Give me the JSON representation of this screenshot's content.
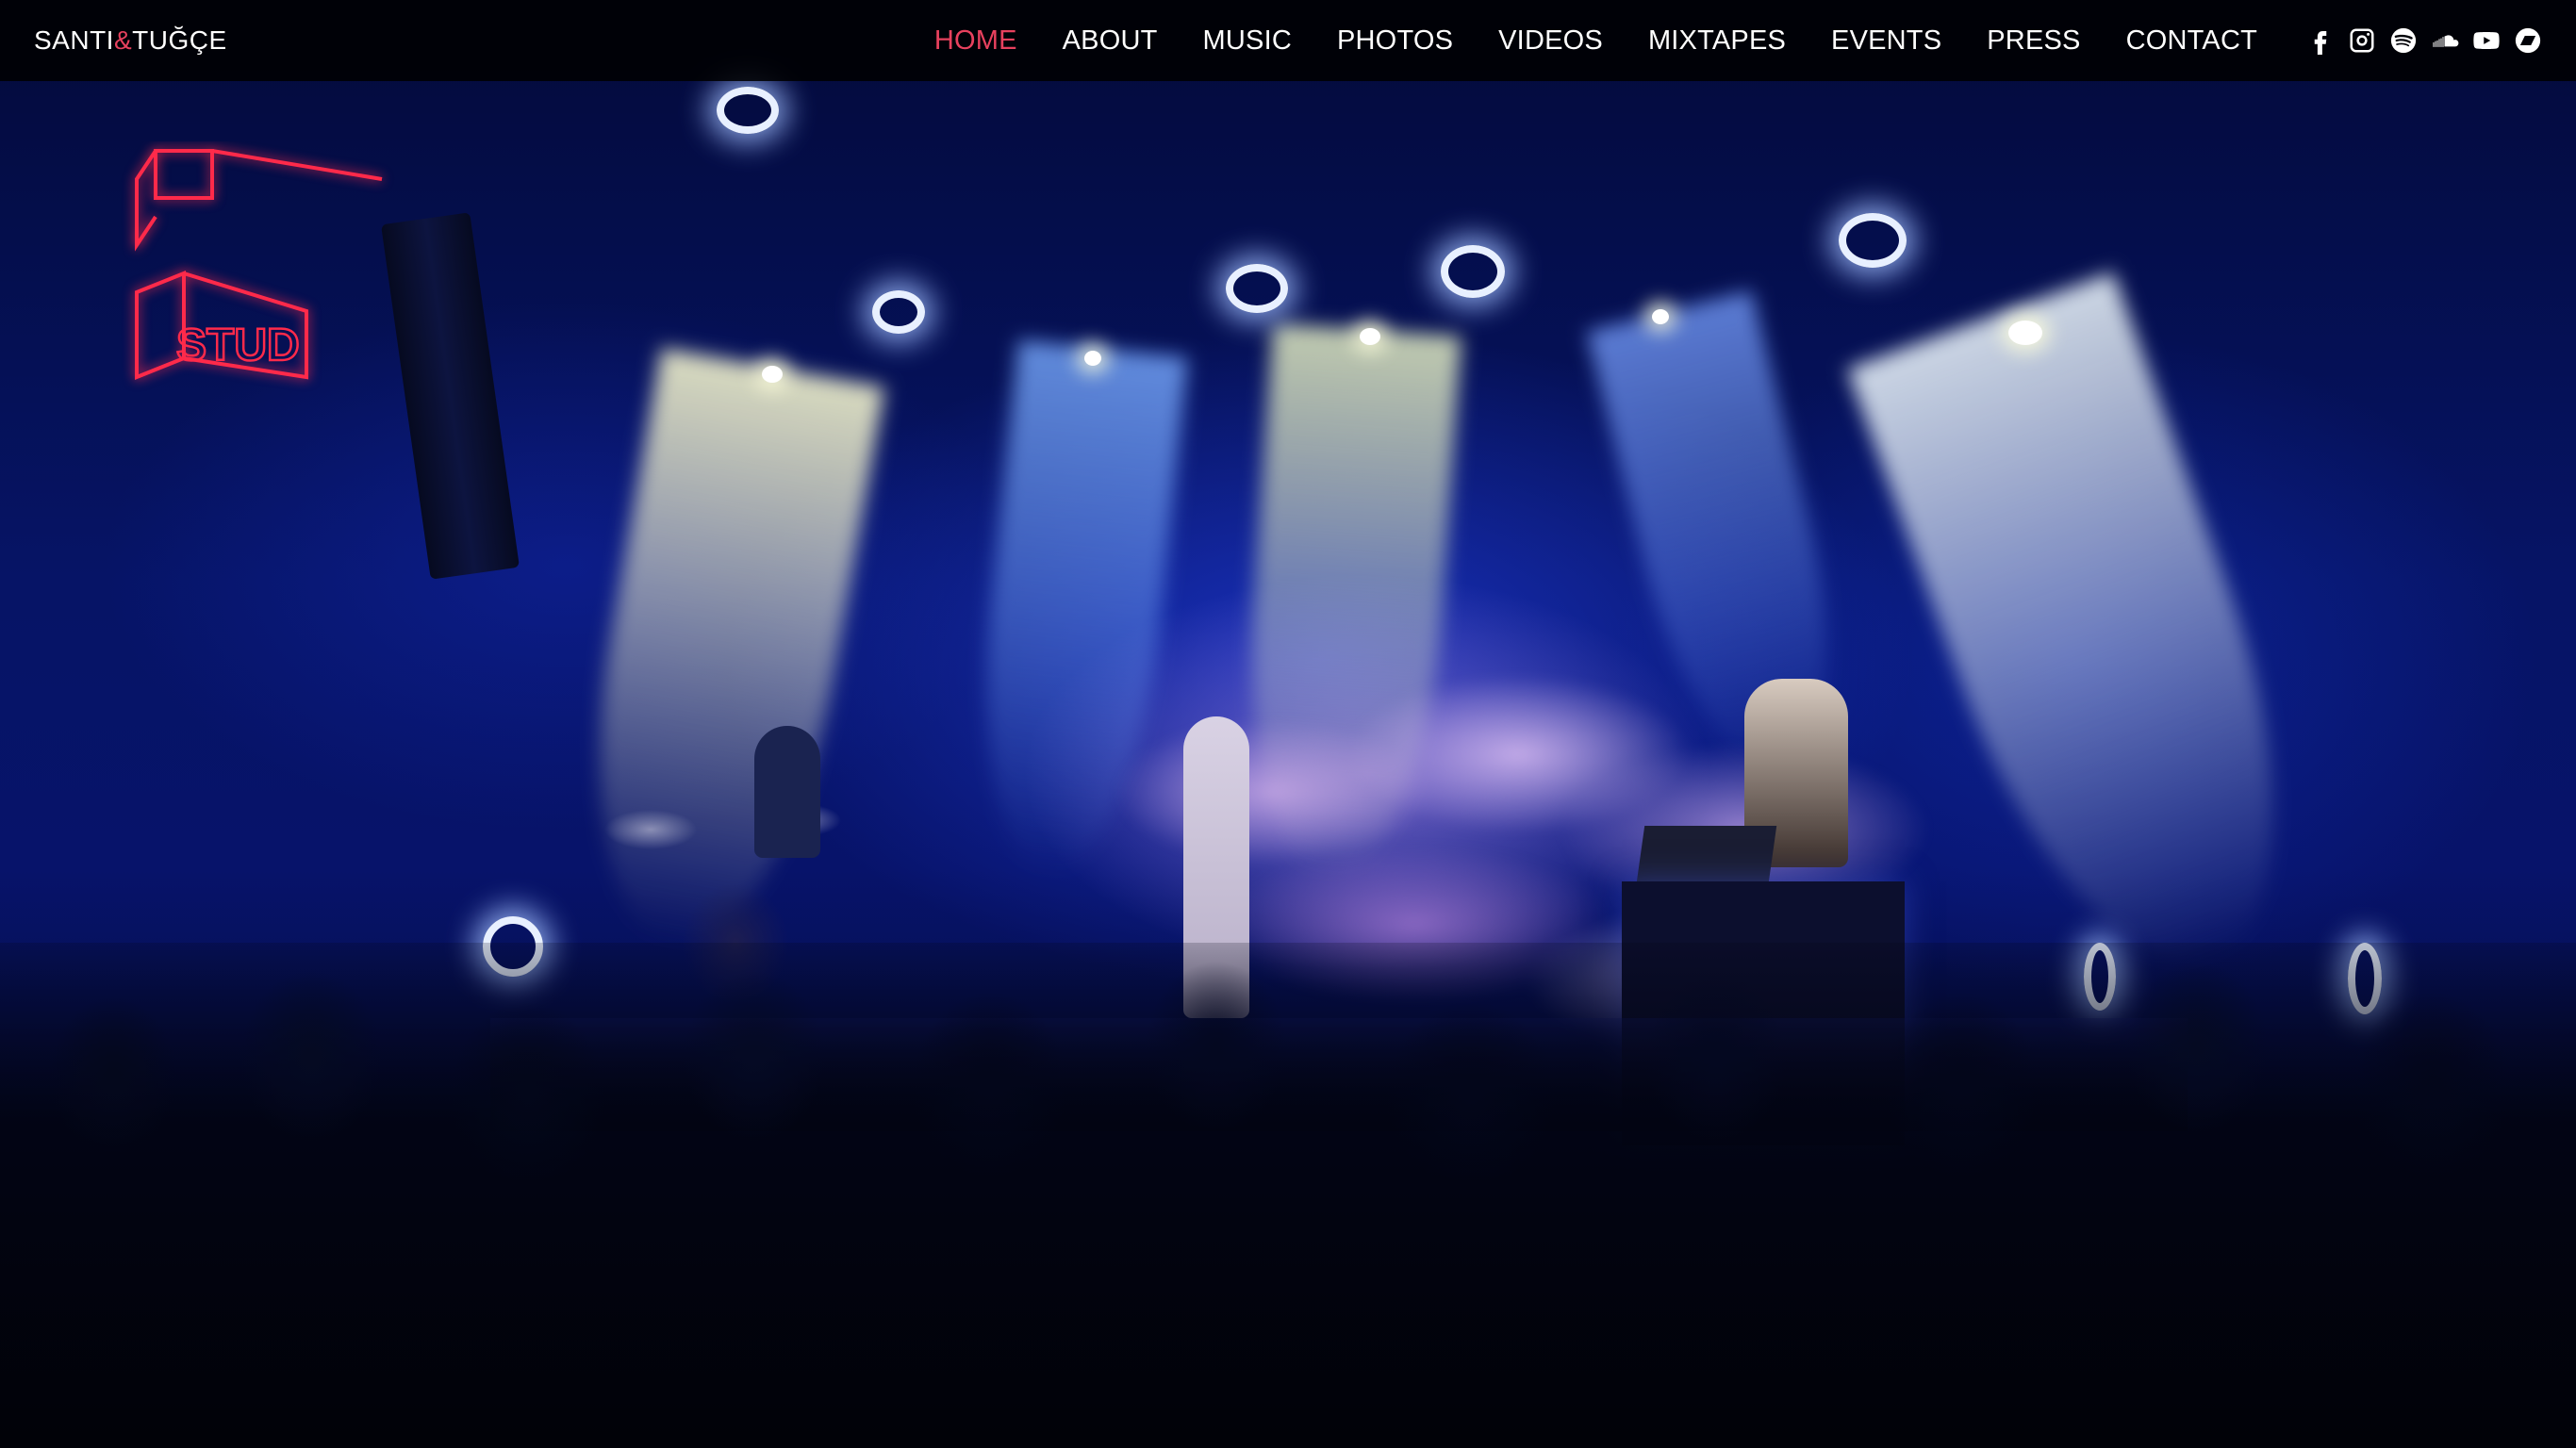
{
  "brand": {
    "name_left": "SANTI",
    "amp": "&",
    "name_right": "TUĞÇE",
    "accent_color": "#e8415e"
  },
  "nav": {
    "items": [
      {
        "label": "HOME",
        "active": true
      },
      {
        "label": "ABOUT",
        "active": false
      },
      {
        "label": "MUSIC",
        "active": false
      },
      {
        "label": "PHOTOS",
        "active": false
      },
      {
        "label": "VIDEOS",
        "active": false
      },
      {
        "label": "MIXTAPES",
        "active": false
      },
      {
        "label": "EVENTS",
        "active": false
      },
      {
        "label": "PRESS",
        "active": false
      },
      {
        "label": "CONTACT",
        "active": false
      }
    ]
  },
  "social": {
    "icons": [
      "facebook-icon",
      "instagram-icon",
      "spotify-icon",
      "soundcloud-icon",
      "youtube-icon",
      "bandcamp-icon"
    ]
  },
  "hero": {
    "neon_sign_text": "STUD",
    "neon_color": "#ff2a4a"
  }
}
